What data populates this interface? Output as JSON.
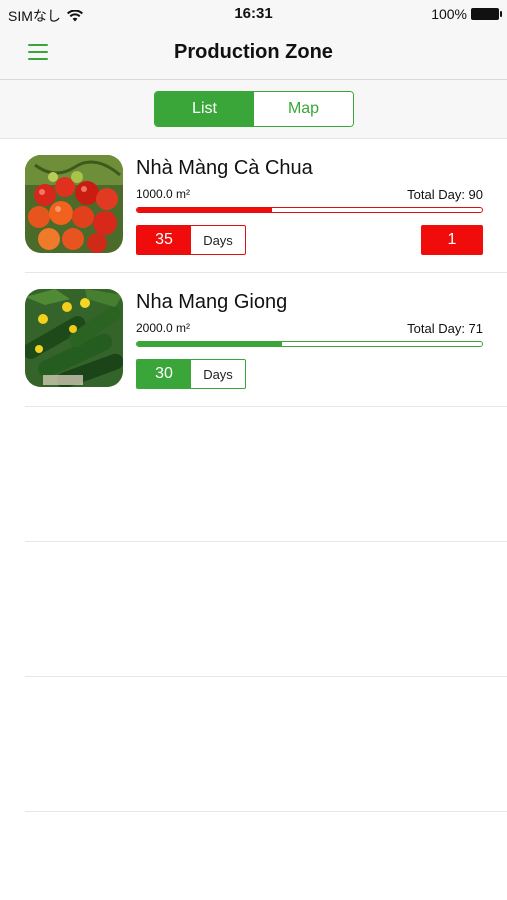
{
  "status_bar": {
    "carrier": "SIMなし",
    "time": "16:31",
    "battery": "100%"
  },
  "nav": {
    "title": "Production Zone"
  },
  "segments": {
    "list_label": "List",
    "map_label": "Map",
    "selected": "List"
  },
  "zones": [
    {
      "name": "Nhà Màng Cà Chua",
      "area": "1000.0 m²",
      "total_day": "Total Day: 90",
      "progress": 0.39,
      "days_value": "35",
      "days_label": "Days",
      "alert_count": "1",
      "status_color": "#f10c0c",
      "image": "tomato-photo"
    },
    {
      "name": "Nha Mang Giong",
      "area": "2000.0 m²",
      "total_day": "Total Day: 71",
      "progress": 0.42,
      "days_value": "30",
      "days_label": "Days",
      "status_color": "#3aa63a",
      "image": "cucumber-photo"
    }
  ],
  "colors": {
    "accent": "#3aa63a",
    "alert": "#f10c0c"
  },
  "icons": {
    "menu": "hamburger-menu-icon",
    "wifi": "wifi-icon",
    "battery": "battery-icon"
  }
}
